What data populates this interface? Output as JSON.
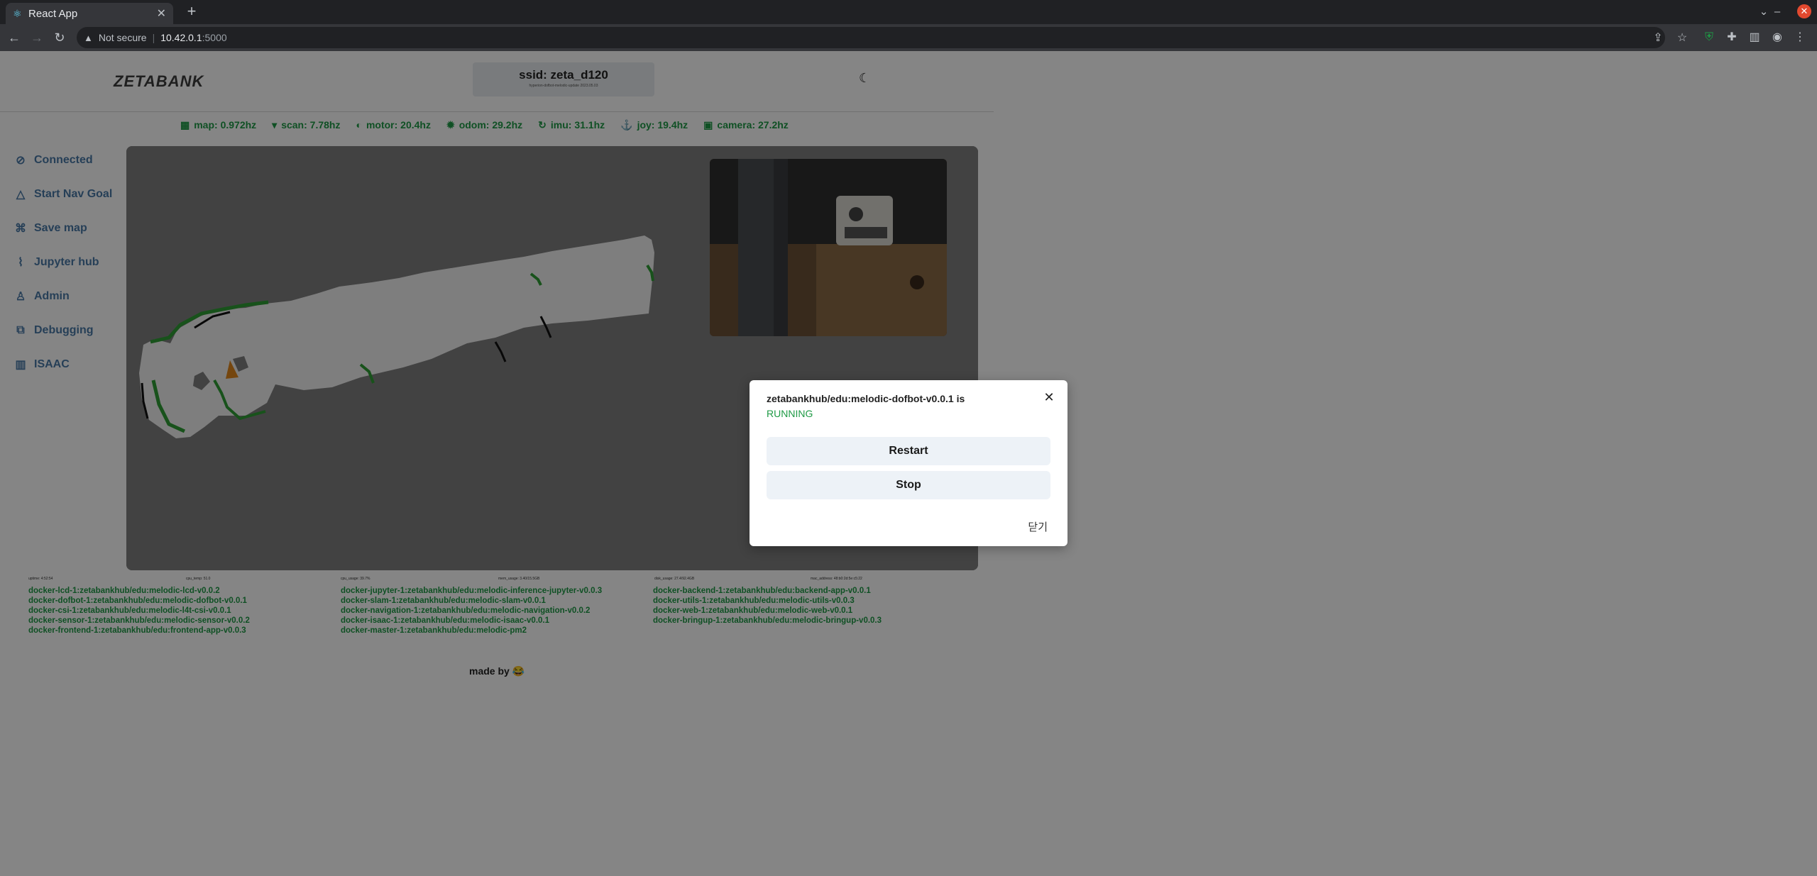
{
  "browser": {
    "tab_title": "React App",
    "tab_favicon": "react-icon",
    "url_warning": "Not secure",
    "url_host": "10.42.0.1",
    "url_port": ":5000"
  },
  "header": {
    "logo": "ZETABANK",
    "ssid": "ssid: zeta_d120",
    "ssid_sub": "hyperion-dofbot-melodic-update 2023.05.03",
    "theme_icon": "moon-icon"
  },
  "hz": [
    {
      "icon": "map-icon",
      "label": "map: 0.972hz"
    },
    {
      "icon": "wifi-icon",
      "label": "scan: 7.78hz"
    },
    {
      "icon": "motor-icon",
      "label": "motor: 20.4hz"
    },
    {
      "icon": "gear-icon",
      "label": "odom: 29.2hz"
    },
    {
      "icon": "imu-icon",
      "label": "imu: 31.1hz"
    },
    {
      "icon": "joystick-icon",
      "label": "joy: 19.4hz"
    },
    {
      "icon": "camera-icon",
      "label": "camera: 27.2hz"
    }
  ],
  "sidebar": {
    "items": [
      {
        "icon": "connected-icon",
        "label": "Connected"
      },
      {
        "icon": "navigation-icon",
        "label": "Start Nav Goal"
      },
      {
        "icon": "save-icon",
        "label": "Save map"
      },
      {
        "icon": "jupyter-icon",
        "label": "Jupyter hub"
      },
      {
        "icon": "admin-icon",
        "label": "Admin"
      },
      {
        "icon": "debug-icon",
        "label": "Debugging"
      },
      {
        "icon": "isaac-icon",
        "label": "ISAAC"
      }
    ]
  },
  "stats": {
    "uptime": "uptime: 4:52:54",
    "cpu_temp": "cpu_temp: 51.0",
    "cpu_usage": "cpu_usage: 39.7%",
    "mem_usage": "mem_usage: 3.40/15.5GB",
    "disk_usage": "disk_usage: 27.4/92.4GB",
    "mac_address": "mac_address: 48:b0:2d:5e:c5:22"
  },
  "docker": {
    "col1": [
      "docker-lcd-1:zetabankhub/edu:melodic-lcd-v0.0.2",
      "docker-dofbot-1:zetabankhub/edu:melodic-dofbot-v0.0.1",
      "docker-csi-1:zetabankhub/edu:melodic-l4t-csi-v0.0.1",
      "docker-sensor-1:zetabankhub/edu:melodic-sensor-v0.0.2",
      "docker-frontend-1:zetabankhub/edu:frontend-app-v0.0.3"
    ],
    "col2": [
      "docker-jupyter-1:zetabankhub/edu:melodic-inference-jupyter-v0.0.3",
      "docker-slam-1:zetabankhub/edu:melodic-slam-v0.0.1",
      "docker-navigation-1:zetabankhub/edu:melodic-navigation-v0.0.2",
      "docker-isaac-1:zetabankhub/edu:melodic-isaac-v0.0.1",
      "docker-master-1:zetabankhub/edu:melodic-pm2"
    ],
    "col3": [
      "docker-backend-1:zetabankhub/edu:backend-app-v0.0.1",
      "docker-utils-1:zetabankhub/edu:melodic-utils-v0.0.3",
      "docker-web-1:zetabankhub/edu:melodic-web-v0.0.1",
      "docker-bringup-1:zetabankhub/edu:melodic-bringup-v0.0.3"
    ]
  },
  "footer": {
    "made_by": "made by 😂"
  },
  "modal": {
    "title": "zetabankhub/edu:melodic-dofbot-v0.0.1 is",
    "status": "RUNNING",
    "restart_label": "Restart",
    "stop_label": "Stop",
    "close_label": "닫기"
  }
}
